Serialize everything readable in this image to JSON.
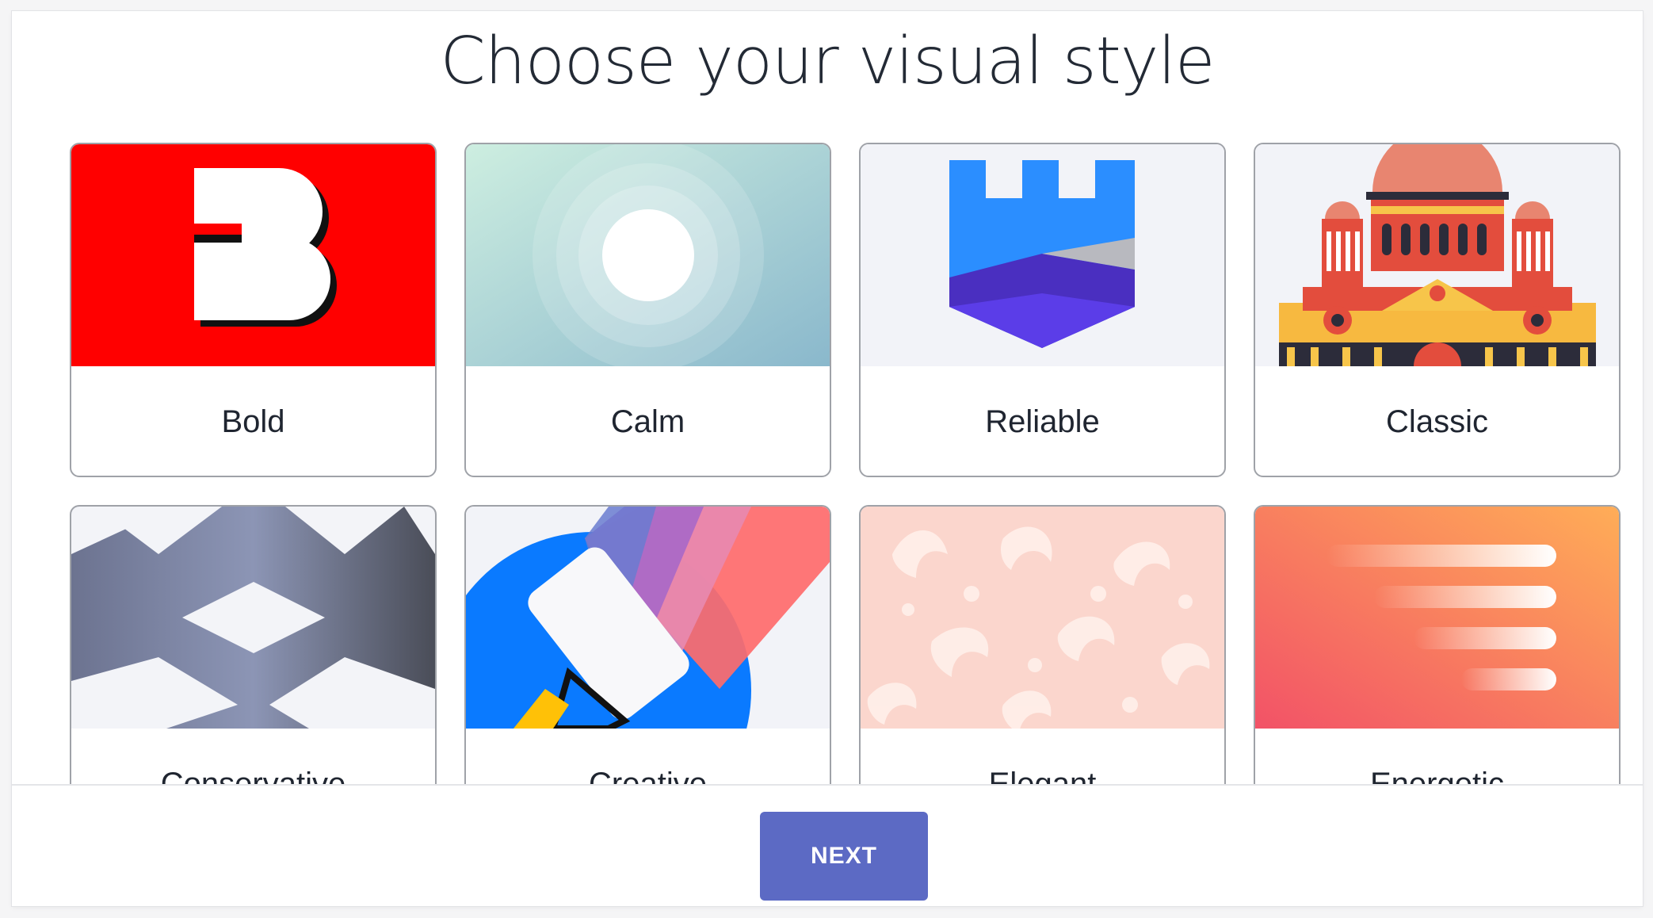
{
  "page": {
    "title": "Choose your visual style"
  },
  "styles": [
    {
      "label": "Bold",
      "icon": "bold-b-icon"
    },
    {
      "label": "Calm",
      "icon": "calm-circles-icon"
    },
    {
      "label": "Reliable",
      "icon": "castle-shield-icon"
    },
    {
      "label": "Classic",
      "icon": "palace-illustration-icon"
    },
    {
      "label": "Conservative",
      "icon": "geometric-diamonds-icon"
    },
    {
      "label": "Creative",
      "icon": "paint-roller-icon"
    },
    {
      "label": "Elegant",
      "icon": "damask-pattern-icon"
    },
    {
      "label": "Energetic",
      "icon": "speed-lines-icon"
    }
  ],
  "footer": {
    "next_label": "NEXT"
  },
  "colors": {
    "accent": "#5c6ac4",
    "bold_red": "#ff0000",
    "reliable_blue": "#2b8eff",
    "reliable_purple": "#5b3de8"
  }
}
